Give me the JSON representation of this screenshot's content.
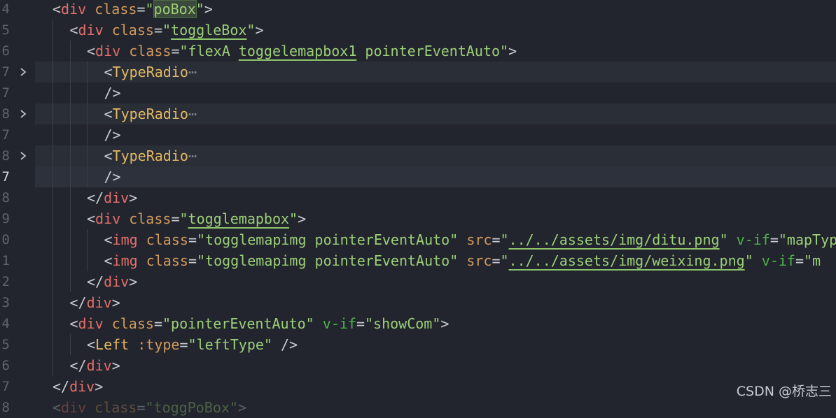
{
  "editor": {
    "lines": [
      {
        "num": "4",
        "fold": false,
        "current": false,
        "shade": false,
        "indent": 1,
        "tokens": [
          {
            "c": "p",
            "v": "<"
          },
          {
            "c": "n",
            "v": "div"
          },
          {
            "c": "t",
            "v": " "
          },
          {
            "c": "a",
            "v": "class"
          },
          {
            "c": "p",
            "v": "="
          },
          {
            "c": "s",
            "v": "\""
          },
          {
            "c": "s mk",
            "v": "poBox"
          },
          {
            "c": "s",
            "v": "\""
          },
          {
            "c": "p",
            "v": ">"
          }
        ]
      },
      {
        "num": "5",
        "fold": false,
        "current": false,
        "shade": false,
        "indent": 2,
        "tokens": [
          {
            "c": "p",
            "v": "<"
          },
          {
            "c": "n",
            "v": "div"
          },
          {
            "c": "t",
            "v": " "
          },
          {
            "c": "a",
            "v": "class"
          },
          {
            "c": "p",
            "v": "="
          },
          {
            "c": "s",
            "v": "\""
          },
          {
            "c": "s lk",
            "v": "toggleBox"
          },
          {
            "c": "s",
            "v": "\""
          },
          {
            "c": "p",
            "v": ">"
          }
        ]
      },
      {
        "num": "6",
        "fold": false,
        "current": false,
        "shade": false,
        "indent": 3,
        "tokens": [
          {
            "c": "p",
            "v": "<"
          },
          {
            "c": "n",
            "v": "div"
          },
          {
            "c": "t",
            "v": " "
          },
          {
            "c": "a",
            "v": "class"
          },
          {
            "c": "p",
            "v": "="
          },
          {
            "c": "s",
            "v": "\"flexA "
          },
          {
            "c": "s lk",
            "v": "toggelemapbox1"
          },
          {
            "c": "s",
            "v": " pointerEventAuto\""
          },
          {
            "c": "p",
            "v": ">"
          }
        ]
      },
      {
        "num": "7",
        "fold": true,
        "current": false,
        "shade": true,
        "indent": 4,
        "tokens": [
          {
            "c": "p",
            "v": "<"
          },
          {
            "c": "comp",
            "v": "TypeRadio"
          },
          {
            "c": "ell",
            "v": "⋯"
          }
        ]
      },
      {
        "num": "7",
        "fold": false,
        "current": false,
        "shade": false,
        "indent": 4,
        "tokens": [
          {
            "c": "p",
            "v": "/>"
          }
        ]
      },
      {
        "num": "8",
        "fold": true,
        "current": false,
        "shade": true,
        "indent": 4,
        "tokens": [
          {
            "c": "p",
            "v": "<"
          },
          {
            "c": "comp",
            "v": "TypeRadio"
          },
          {
            "c": "ell",
            "v": "⋯"
          }
        ]
      },
      {
        "num": "7",
        "fold": false,
        "current": false,
        "shade": false,
        "indent": 4,
        "tokens": [
          {
            "c": "p",
            "v": "/>"
          }
        ]
      },
      {
        "num": "8",
        "fold": true,
        "current": false,
        "shade": true,
        "indent": 4,
        "tokens": [
          {
            "c": "p",
            "v": "<"
          },
          {
            "c": "comp",
            "v": "TypeRadio"
          },
          {
            "c": "ell",
            "v": "⋯"
          }
        ]
      },
      {
        "num": "7",
        "fold": false,
        "current": true,
        "shade": false,
        "indent": 4,
        "tokens": [
          {
            "c": "p",
            "v": "/>"
          }
        ]
      },
      {
        "num": "8",
        "fold": false,
        "current": false,
        "shade": false,
        "indent": 3,
        "tokens": [
          {
            "c": "p",
            "v": "</"
          },
          {
            "c": "n",
            "v": "div"
          },
          {
            "c": "p",
            "v": ">"
          }
        ]
      },
      {
        "num": "9",
        "fold": false,
        "current": false,
        "shade": false,
        "indent": 3,
        "tokens": [
          {
            "c": "p",
            "v": "<"
          },
          {
            "c": "n",
            "v": "div"
          },
          {
            "c": "t",
            "v": " "
          },
          {
            "c": "a",
            "v": "class"
          },
          {
            "c": "p",
            "v": "="
          },
          {
            "c": "s",
            "v": "\""
          },
          {
            "c": "s lk",
            "v": "togglemapbox"
          },
          {
            "c": "s",
            "v": "\""
          },
          {
            "c": "p",
            "v": ">"
          }
        ]
      },
      {
        "num": "0",
        "fold": false,
        "current": false,
        "shade": false,
        "indent": 4,
        "tokens": [
          {
            "c": "p",
            "v": "<"
          },
          {
            "c": "n",
            "v": "img"
          },
          {
            "c": "t",
            "v": " "
          },
          {
            "c": "a",
            "v": "class"
          },
          {
            "c": "p",
            "v": "="
          },
          {
            "c": "s",
            "v": "\"togglemapimg pointerEventAuto\""
          },
          {
            "c": "t",
            "v": " "
          },
          {
            "c": "a",
            "v": "src"
          },
          {
            "c": "p",
            "v": "="
          },
          {
            "c": "s",
            "v": "\""
          },
          {
            "c": "s lk",
            "v": "../../assets/img/ditu.png"
          },
          {
            "c": "s",
            "v": "\""
          },
          {
            "c": "t",
            "v": " "
          },
          {
            "c": "d",
            "v": "v-if"
          },
          {
            "c": "p",
            "v": "="
          },
          {
            "c": "s",
            "v": "\"mapType"
          }
        ]
      },
      {
        "num": "1",
        "fold": false,
        "current": false,
        "shade": false,
        "indent": 4,
        "tokens": [
          {
            "c": "p",
            "v": "<"
          },
          {
            "c": "n",
            "v": "img"
          },
          {
            "c": "t",
            "v": " "
          },
          {
            "c": "a",
            "v": "class"
          },
          {
            "c": "p",
            "v": "="
          },
          {
            "c": "s",
            "v": "\"togglemapimg pointerEventAuto\""
          },
          {
            "c": "t",
            "v": " "
          },
          {
            "c": "a",
            "v": "src"
          },
          {
            "c": "p",
            "v": "="
          },
          {
            "c": "s",
            "v": "\""
          },
          {
            "c": "s lk",
            "v": "../../assets/img/weixing.png"
          },
          {
            "c": "s",
            "v": "\""
          },
          {
            "c": "t",
            "v": " "
          },
          {
            "c": "d",
            "v": "v-if"
          },
          {
            "c": "p",
            "v": "="
          },
          {
            "c": "s",
            "v": "\"m"
          }
        ]
      },
      {
        "num": "2",
        "fold": false,
        "current": false,
        "shade": false,
        "indent": 3,
        "tokens": [
          {
            "c": "p",
            "v": "</"
          },
          {
            "c": "n",
            "v": "div"
          },
          {
            "c": "p",
            "v": ">"
          }
        ]
      },
      {
        "num": "3",
        "fold": false,
        "current": false,
        "shade": false,
        "indent": 2,
        "tokens": [
          {
            "c": "p",
            "v": "</"
          },
          {
            "c": "n",
            "v": "div"
          },
          {
            "c": "p",
            "v": ">"
          }
        ]
      },
      {
        "num": "4",
        "fold": false,
        "current": false,
        "shade": false,
        "indent": 2,
        "tokens": [
          {
            "c": "p",
            "v": "<"
          },
          {
            "c": "n",
            "v": "div"
          },
          {
            "c": "t",
            "v": " "
          },
          {
            "c": "a",
            "v": "class"
          },
          {
            "c": "p",
            "v": "="
          },
          {
            "c": "s",
            "v": "\"pointerEventAuto\""
          },
          {
            "c": "t",
            "v": " "
          },
          {
            "c": "d",
            "v": "v-if"
          },
          {
            "c": "p",
            "v": "="
          },
          {
            "c": "s",
            "v": "\"showCom\""
          },
          {
            "c": "p",
            "v": ">"
          }
        ]
      },
      {
        "num": "5",
        "fold": false,
        "current": false,
        "shade": false,
        "indent": 3,
        "tokens": [
          {
            "c": "p",
            "v": "<"
          },
          {
            "c": "comp",
            "v": "Left"
          },
          {
            "c": "t",
            "v": " "
          },
          {
            "c": "a",
            "v": ":type"
          },
          {
            "c": "p",
            "v": "="
          },
          {
            "c": "s",
            "v": "\"leftType\""
          },
          {
            "c": "t",
            "v": " "
          },
          {
            "c": "p",
            "v": "/>"
          }
        ]
      },
      {
        "num": "6",
        "fold": false,
        "current": false,
        "shade": false,
        "indent": 2,
        "tokens": [
          {
            "c": "p",
            "v": "</"
          },
          {
            "c": "n",
            "v": "div"
          },
          {
            "c": "p",
            "v": ">"
          }
        ]
      },
      {
        "num": "7",
        "fold": false,
        "current": false,
        "shade": false,
        "indent": 1,
        "tokens": [
          {
            "c": "p",
            "v": "</"
          },
          {
            "c": "n",
            "v": "div"
          },
          {
            "c": "p",
            "v": ">"
          }
        ]
      },
      {
        "num": "8",
        "fold": false,
        "current": false,
        "shade": false,
        "indent": 1,
        "dim": true,
        "tokens": [
          {
            "c": "p",
            "v": "<"
          },
          {
            "c": "n",
            "v": "div"
          },
          {
            "c": "t",
            "v": " "
          },
          {
            "c": "a",
            "v": "class"
          },
          {
            "c": "p",
            "v": "="
          },
          {
            "c": "s",
            "v": "\"toggPoBox\""
          },
          {
            "c": "p",
            "v": ">"
          }
        ]
      }
    ]
  },
  "watermark": "CSDN @桥志三",
  "icons": {
    "fold": "chevron-right-icon"
  }
}
